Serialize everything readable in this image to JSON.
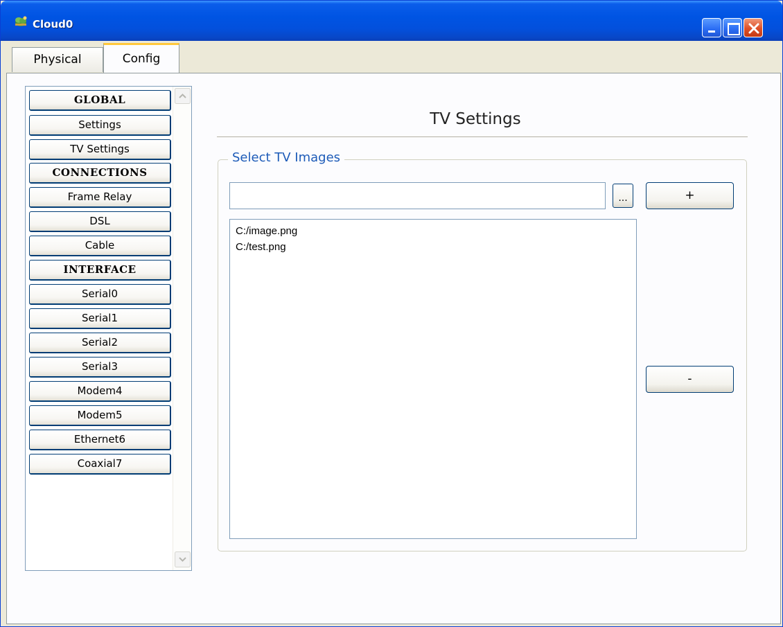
{
  "window": {
    "title": "Cloud0",
    "accent_color": "#0054e3",
    "icon": "cloud-device-icon"
  },
  "tabs": [
    {
      "label": "Physical",
      "active": false
    },
    {
      "label": "Config",
      "active": true
    }
  ],
  "sidebar": {
    "items": [
      {
        "label": "GLOBAL",
        "header": true
      },
      {
        "label": "Settings",
        "header": false
      },
      {
        "label": "TV Settings",
        "header": false
      },
      {
        "label": "CONNECTIONS",
        "header": true
      },
      {
        "label": "Frame Relay",
        "header": false
      },
      {
        "label": "DSL",
        "header": false
      },
      {
        "label": "Cable",
        "header": false
      },
      {
        "label": "INTERFACE",
        "header": true
      },
      {
        "label": "Serial0",
        "header": false
      },
      {
        "label": "Serial1",
        "header": false
      },
      {
        "label": "Serial2",
        "header": false
      },
      {
        "label": "Serial3",
        "header": false
      },
      {
        "label": "Modem4",
        "header": false
      },
      {
        "label": "Modem5",
        "header": false
      },
      {
        "label": "Ethernet6",
        "header": false
      },
      {
        "label": "Coaxial7",
        "header": false
      }
    ]
  },
  "main": {
    "title": "TV Settings",
    "group": {
      "legend": "Select TV Images",
      "path_value": "",
      "browse_label": "...",
      "add_label": "+",
      "remove_label": "-",
      "images": [
        "C:/image.png",
        "C:/test.png"
      ]
    }
  }
}
